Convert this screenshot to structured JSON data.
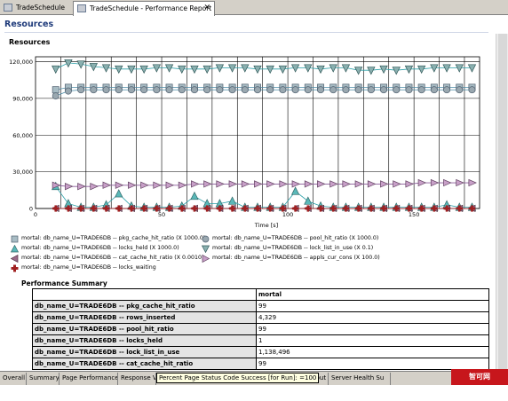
{
  "tabs": [
    {
      "label": "TradeSchedule"
    },
    {
      "label": "TradeSchedule - Performance Report"
    }
  ],
  "page_title": "Resources",
  "section_title": "Resources",
  "chart_data": {
    "type": "line",
    "xlabel": "Time [s]",
    "xlim": [
      0,
      176
    ],
    "ylim": [
      0,
      124000
    ],
    "xticks": [
      0,
      50,
      100,
      150
    ],
    "yticks": [
      0,
      30000,
      60000,
      90000,
      120000
    ],
    "ytick_labels": [
      "0",
      "30,000",
      "60,000",
      "90,000",
      "120,000"
    ],
    "x": [
      8,
      13,
      18,
      23,
      28,
      33,
      38,
      43,
      48,
      53,
      58,
      63,
      68,
      73,
      78,
      83,
      88,
      93,
      98,
      103,
      108,
      113,
      118,
      123,
      128,
      133,
      138,
      143,
      148,
      153,
      158,
      163,
      168,
      173
    ],
    "series": [
      {
        "name": "mortal: db_name_U=TRADE6DB -- pkg_cache_hit_ratio (X 1000.0)",
        "color": "#4a8ca8",
        "marker": "square",
        "values": [
          97000,
          99000,
          99000,
          99000,
          99000,
          99000,
          99000,
          99000,
          99000,
          99000,
          99000,
          99000,
          99000,
          99000,
          99000,
          99000,
          99000,
          99000,
          99000,
          99000,
          99000,
          99000,
          99000,
          99000,
          99000,
          99000,
          99000,
          99000,
          99000,
          99000,
          99000,
          99000,
          99000,
          99000
        ]
      },
      {
        "name": "mortal: db_name_U=TRADE6DB -- pool_hit_ratio (X 1000.0)",
        "color": "#4a8ca8",
        "marker": "circle",
        "values": [
          92000,
          96000,
          97000,
          97000,
          97000,
          97000,
          97000,
          97000,
          97000,
          97000,
          97000,
          97000,
          97000,
          97000,
          97000,
          97000,
          97000,
          97000,
          97000,
          97000,
          97000,
          97000,
          97000,
          97000,
          97000,
          97000,
          97000,
          97000,
          97000,
          97000,
          97000,
          97000,
          97000,
          97000
        ]
      },
      {
        "name": "mortal: db_name_U=TRADE6DB -- locks_held (X 1000.0)",
        "color": "#2aa0a8",
        "marker": "triangle-up",
        "values": [
          18000,
          4000,
          1000,
          1000,
          3000,
          12000,
          2000,
          1000,
          1000,
          1000,
          2000,
          10000,
          4000,
          4000,
          6000,
          1000,
          1000,
          1000,
          1000,
          14000,
          6000,
          2000,
          1000,
          1000,
          1000,
          1000,
          1000,
          1000,
          1000,
          1000,
          1000,
          3000,
          1000,
          1000
        ]
      },
      {
        "name": "mortal: db_name_U=TRADE6DB -- lock_list_in_use (X 0.1)",
        "color": "#2aa0a8",
        "marker": "triangle-down",
        "values": [
          114000,
          119000,
          118000,
          116000,
          115000,
          114000,
          114000,
          114000,
          115000,
          115000,
          114000,
          114000,
          114000,
          115000,
          115000,
          115000,
          114000,
          114000,
          114000,
          115000,
          115000,
          114000,
          115000,
          115000,
          113000,
          113000,
          114000,
          113000,
          114000,
          114000,
          115000,
          115000,
          115000,
          115000
        ]
      },
      {
        "name": "mortal: db_name_U=TRADE6DB -- cat_cache_hit_ratio (X 0.0010)",
        "color": "#7a4a6a",
        "marker": "triangle-left",
        "values": [
          100,
          100,
          100,
          100,
          100,
          100,
          100,
          100,
          100,
          100,
          100,
          100,
          100,
          100,
          100,
          100,
          100,
          100,
          100,
          100,
          100,
          100,
          100,
          100,
          100,
          100,
          100,
          100,
          100,
          100,
          100,
          100,
          100,
          100
        ]
      },
      {
        "name": "mortal: db_name_U=TRADE6DB -- appls_cur_cons (X 100.0)",
        "color": "#8a5a9a",
        "marker": "triangle-right",
        "values": [
          19000,
          18000,
          18000,
          18000,
          19000,
          19000,
          19000,
          19000,
          19000,
          19000,
          19000,
          20000,
          20000,
          20000,
          20000,
          20000,
          20000,
          20000,
          20000,
          20000,
          20000,
          20000,
          20000,
          20000,
          20000,
          20000,
          20000,
          20000,
          20000,
          21000,
          21000,
          21000,
          21000,
          21000
        ]
      },
      {
        "name": "mortal: db_name_U=TRADE6DB -- locks_waiting",
        "color": "#a02020",
        "marker": "plus",
        "values": [
          0,
          0,
          0,
          0,
          0,
          0,
          0,
          0,
          0,
          0,
          0,
          0,
          0,
          0,
          0,
          0,
          0,
          0,
          0,
          0,
          0,
          0,
          0,
          0,
          0,
          0,
          0,
          0,
          0,
          0,
          0,
          0,
          0,
          0
        ]
      }
    ]
  },
  "summary": {
    "title": "Performance Summary",
    "column_header": "mortal",
    "rows": [
      {
        "name": "db_name_U=TRADE6DB -- pkg_cache_hit_ratio",
        "value": "99"
      },
      {
        "name": "db_name_U=TRADE6DB -- rows_inserted",
        "value": "4,329"
      },
      {
        "name": "db_name_U=TRADE6DB -- pool_hit_ratio",
        "value": "99"
      },
      {
        "name": "db_name_U=TRADE6DB -- locks_held",
        "value": "1"
      },
      {
        "name": "db_name_U=TRADE6DB -- lock_list_in_use",
        "value": "1,138,496"
      },
      {
        "name": "db_name_U=TRADE6DB -- cat_cache_hit_ratio",
        "value": "99"
      }
    ]
  },
  "bottom_tabs": [
    {
      "label": "Overall"
    },
    {
      "label": "Summary"
    },
    {
      "label": "Page Performance"
    },
    {
      "label": "Response V"
    },
    {
      "label": "hput"
    },
    {
      "label": "Server Health Su"
    }
  ],
  "tooltip": "Percent Page Status Code Success [for Run]: =100",
  "watermark": "智可网 www.hzhike.com",
  "colors": {
    "title": "#1e3a7a",
    "tabbar": "#d4d0c8",
    "tooltip_bg": "#ffffe1",
    "watermark_bg": "#c7161c"
  }
}
